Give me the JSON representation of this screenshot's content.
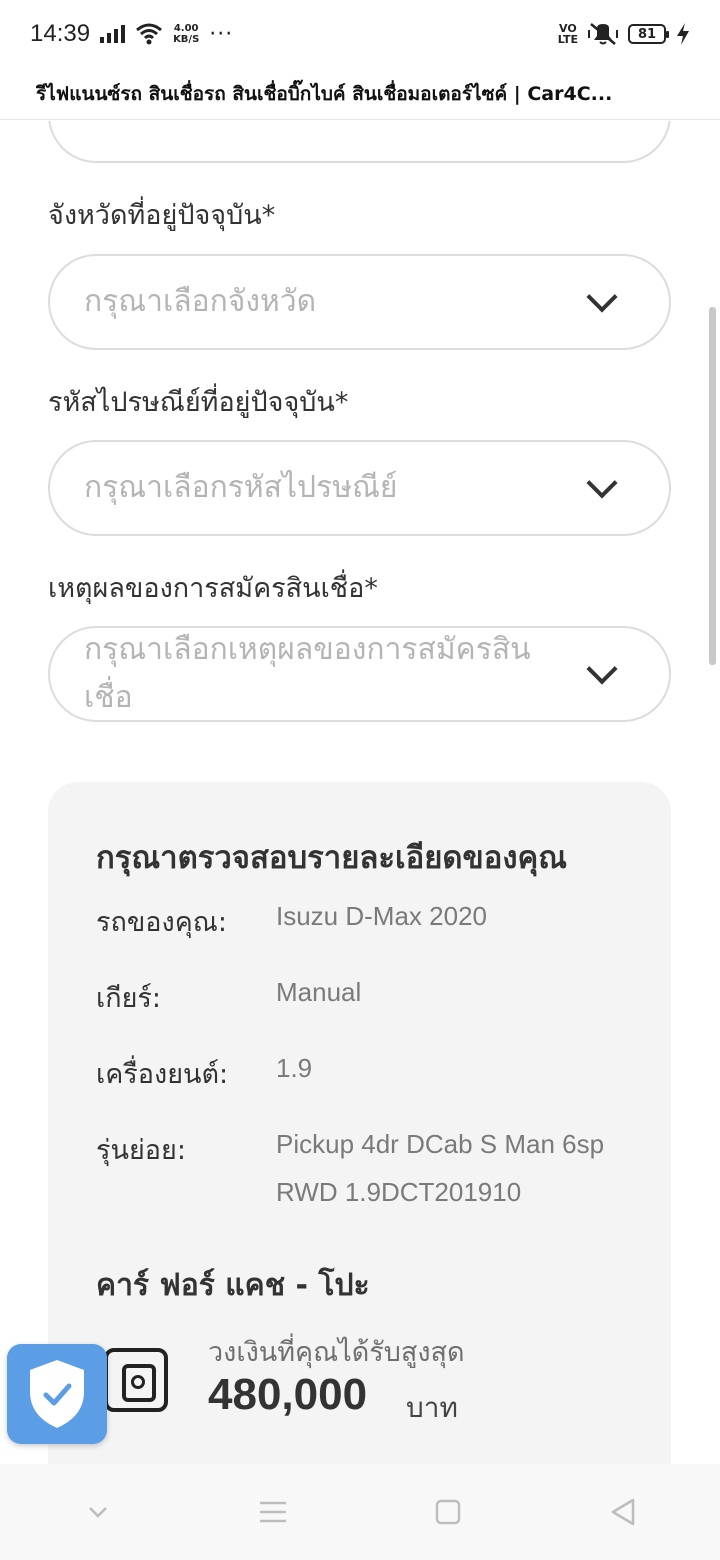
{
  "status_bar": {
    "time": "14:39",
    "net_speed_value": "4.00",
    "net_speed_unit": "KB/S",
    "more": "···",
    "volte_top": "VO",
    "volte_bottom": "LTE",
    "battery": "81"
  },
  "browser": {
    "title": "รีไฟแนนซ์รถ สินเชื่อรถ สินเชื่อบิ๊กไบค์ สินเชื่อมอเตอร์ไซค์ | Car4C..."
  },
  "form": {
    "province_label": "จังหวัดที่อยู่ปัจจุบัน*",
    "province_placeholder": "กรุณาเลือกจังหวัด",
    "postcode_label": "รหัสไปรษณีย์ที่อยู่ปัจจุบัน*",
    "postcode_placeholder": "กรุณาเลือกรหัสไปรษณีย์",
    "reason_label": "เหตุผลของการสมัครสินเชื่อ*",
    "reason_placeholder": "กรุณาเลือกเหตุผลของการสมัครสินเชื่อ"
  },
  "review": {
    "title": "กรุณาตรวจสอบรายละเอียดของคุณ",
    "rows": [
      {
        "label": "รถของคุณ:",
        "value": "Isuzu D-Max 2020"
      },
      {
        "label": "เกียร์:",
        "value": "Manual"
      },
      {
        "label": "เครื่องยนต์:",
        "value": "1.9"
      },
      {
        "label": "รุ่นย่อย:",
        "value": "Pickup 4dr DCab S Man 6sp RWD 1.9DCT201910"
      }
    ],
    "lender": "คาร์ ฟอร์ แคช - โปะ",
    "max_label": "วงเงินที่คุณได้รับสูงสุด",
    "amount": "480,000",
    "currency": "บาท"
  },
  "icons": {
    "signal": "signal-icon",
    "wifi": "wifi-icon",
    "mute": "vibrate-mute-icon",
    "charging": "charging-icon",
    "shield": "shield-check-icon",
    "money": "money-icon"
  },
  "colors": {
    "badge": "#5b9ee6",
    "card_bg": "#f4f4f4",
    "placeholder": "#b4b4b4"
  }
}
